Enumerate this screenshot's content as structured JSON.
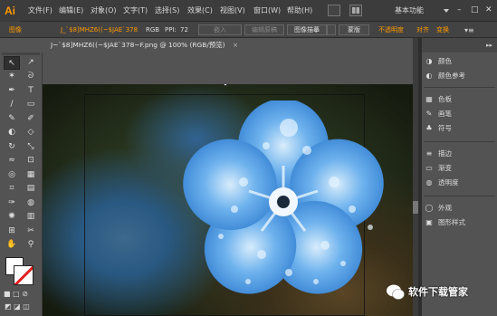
{
  "app": {
    "logo": "Ai",
    "title": "Adobe Illustrator"
  },
  "menubar": {
    "items": [
      "文件(F)",
      "编辑(E)",
      "对象(O)",
      "文字(T)",
      "选择(S)",
      "效果(C)",
      "视图(V)",
      "窗口(W)",
      "帮助(H)"
    ],
    "workspace": "基本功能",
    "window_controls": [
      "–",
      "□",
      "✕"
    ]
  },
  "control_bar": {
    "mode_label": "图像",
    "filename": "J_`$8]MHZ6((~$JAE`378",
    "color_mode": "RGB",
    "ppi_label": "PPI:",
    "ppi_value": "72",
    "embed_button": "嵌入",
    "edit_original_button": "编辑原稿",
    "image_trace_button": "图像描摹",
    "mask_button": "蒙版",
    "opacity_label": "不透明度",
    "align_label": "对齐",
    "transform_label": "变换"
  },
  "document_tab": {
    "label": "J~`$8]MHZ6((~$JAE`378~F.png @ 100% (RGB/预览)",
    "close": "×"
  },
  "tools": {
    "icons": [
      "selection-icon",
      "direct-selection-icon",
      "magic-wand-icon",
      "lasso-icon",
      "pen-icon",
      "type-icon",
      "line-icon",
      "rectangle-icon",
      "paintbrush-icon",
      "pencil-icon",
      "blob-brush-icon",
      "eraser-icon",
      "rotate-icon",
      "scale-icon",
      "width-icon",
      "free-transform-icon",
      "shape-builder-icon",
      "perspective-icon",
      "mesh-icon",
      "gradient-icon",
      "eyedropper-icon",
      "blend-icon",
      "symbol-sprayer-icon",
      "column-graph-icon",
      "artboard-icon",
      "slice-icon",
      "hand-icon",
      "zoom-icon"
    ],
    "glyphs": [
      "↖",
      "↗",
      "✶",
      "ᘐ",
      "✒",
      "T",
      "/",
      "▭",
      "✎",
      "✐",
      "◐",
      "◇",
      "↻",
      "⤡",
      "≈",
      "⊡",
      "◎",
      "▦",
      "⌗",
      "▤",
      "✑",
      "◍",
      "✺",
      "▥",
      "⊞",
      "✂",
      "✋",
      "⚲"
    ]
  },
  "panel": {
    "items": [
      {
        "icon": "color-icon",
        "glyph": "◑",
        "label": "颜色"
      },
      {
        "icon": "color-guide-icon",
        "glyph": "◐",
        "label": "颜色参考"
      },
      {
        "icon": "swatches-icon",
        "glyph": "▦",
        "label": "色板"
      },
      {
        "icon": "brushes-icon",
        "glyph": "✎",
        "label": "画笔"
      },
      {
        "icon": "symbols-icon",
        "glyph": "♣",
        "label": "符号"
      },
      {
        "icon": "stroke-icon",
        "glyph": "≡",
        "label": "描边"
      },
      {
        "icon": "gradient-icon",
        "glyph": "▭",
        "label": "渐变"
      },
      {
        "icon": "transparency-icon",
        "glyph": "◍",
        "label": "透明度"
      },
      {
        "icon": "appearance-icon",
        "glyph": "◯",
        "label": "外观"
      },
      {
        "icon": "graphic-styles-icon",
        "glyph": "▣",
        "label": "图形样式"
      }
    ]
  },
  "watermark": {
    "text": "软件下载管家"
  },
  "colors": {
    "accent": "#ff9a00",
    "menubar": "#3c3c3c",
    "panel": "#535353",
    "flower": "#4a9be0"
  }
}
